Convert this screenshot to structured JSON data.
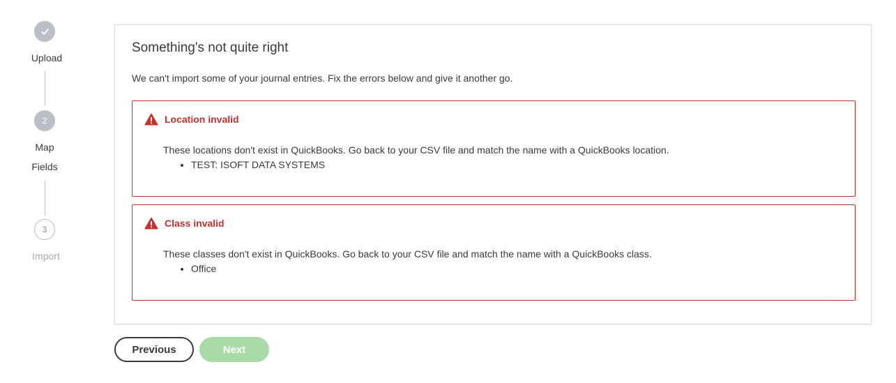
{
  "stepper": {
    "steps": [
      {
        "number": "",
        "label_line1": "Upload",
        "label_line2": "",
        "state": "done"
      },
      {
        "number": "2",
        "label_line1": "Map",
        "label_line2": "Fields",
        "state": "current"
      },
      {
        "number": "3",
        "label_line1": "Import",
        "label_line2": "",
        "state": "future"
      }
    ]
  },
  "card": {
    "title": "Something's not quite right",
    "description": "We can't import some of your journal entries. Fix the errors below and give it another go.",
    "errors": [
      {
        "title": "Location invalid",
        "message": "These locations don't exist in QuickBooks. Go back to your CSV file and match the name with a QuickBooks location.",
        "items": [
          "TEST: ISOFT DATA SYSTEMS"
        ],
        "icon": "warning-triangle-icon"
      },
      {
        "title": "Class invalid",
        "message": "These classes don't exist in QuickBooks. Go back to your CSV file and match the name with a QuickBooks class.",
        "items": [
          "Office"
        ],
        "icon": "warning-triangle-icon"
      }
    ]
  },
  "buttons": {
    "previous_label": "Previous",
    "next_label": "Next",
    "next_disabled": true
  },
  "colors": {
    "error": "#c9302c",
    "next_disabled_bg": "#a8dba7",
    "stepper_gray": "#babec5"
  }
}
